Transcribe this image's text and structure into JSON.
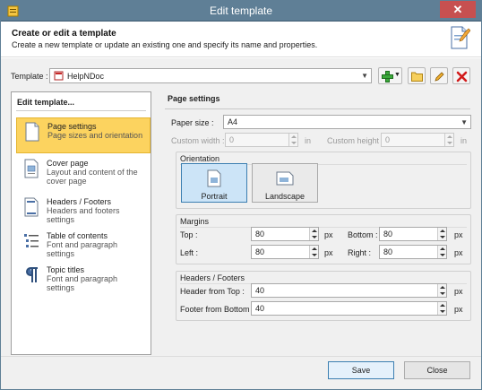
{
  "window": {
    "title": "Edit template",
    "close_glyph": "✕"
  },
  "header": {
    "title": "Create or edit a template",
    "subtitle": "Create a new template or update an existing one and specify its name and properties."
  },
  "template": {
    "label": "Template :",
    "value": "HelpNDoc"
  },
  "toolbar": {
    "icons": [
      "add-icon",
      "dropdown-icon",
      "folder-icon",
      "pencil-icon",
      "delete-icon"
    ]
  },
  "left": {
    "title": "Edit template...",
    "items": [
      {
        "label": "Page settings",
        "desc": "Page sizes and orientation"
      },
      {
        "label": "Cover page",
        "desc": "Layout and content of the cover page"
      },
      {
        "label": "Headers / Footers",
        "desc": "Headers and footers settings"
      },
      {
        "label": "Table of contents",
        "desc": "Font and paragraph settings"
      },
      {
        "label": "Topic titles",
        "desc": "Font and paragraph settings"
      }
    ]
  },
  "page": {
    "title": "Page settings",
    "paper_size_label": "Paper size :",
    "paper_size": "A4",
    "custom_width_label": "Custom width :",
    "custom_width": "0",
    "custom_height_label": "Custom height :",
    "custom_height": "0",
    "unit_in": "in",
    "orientation": {
      "title": "Orientation",
      "portrait": "Portrait",
      "landscape": "Landscape",
      "selected": "Portrait"
    },
    "margins": {
      "title": "Margins",
      "top_label": "Top :",
      "top": "80",
      "bottom_label": "Bottom :",
      "bottom": "80",
      "left_label": "Left :",
      "left": "80",
      "right_label": "Right :",
      "right": "80",
      "unit": "px"
    },
    "hf": {
      "title": "Headers / Footers",
      "header_label": "Header from Top :",
      "header": "40",
      "footer_label": "Footer from Bottom :",
      "footer": "40",
      "unit": "px"
    }
  },
  "footer": {
    "save": "Save",
    "close": "Close"
  },
  "colors": {
    "titlebar": "#5f7f96",
    "selected_item": "#fcd35f",
    "close_button": "#c75050",
    "default_button_border": "#3c7fb1"
  }
}
